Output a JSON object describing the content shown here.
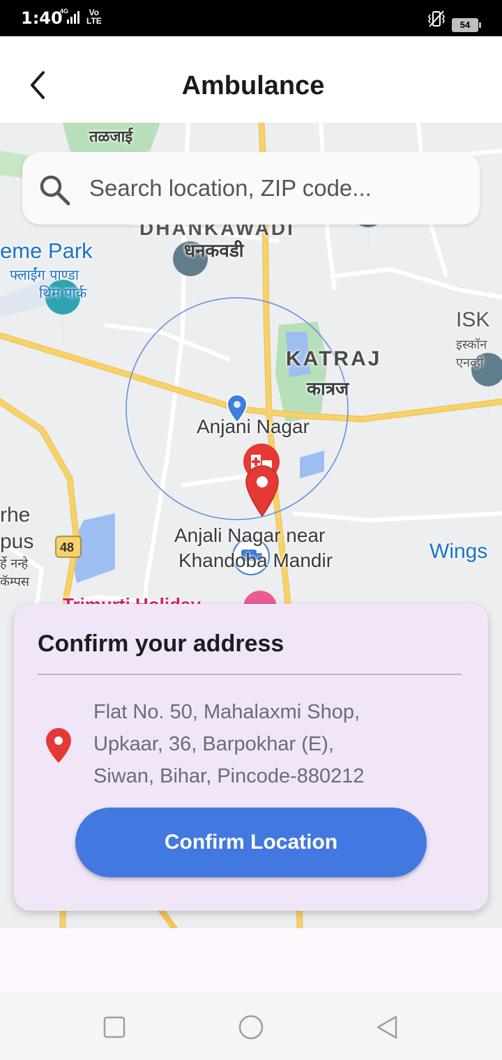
{
  "status_bar": {
    "time": "1:40",
    "network": "4G",
    "volte_top": "Vo",
    "volte_bottom": "LTE",
    "battery": "54"
  },
  "app_bar": {
    "title": "Ambulance",
    "back_icon": "back-arrow-icon"
  },
  "search": {
    "placeholder": "Search location, ZIP code...",
    "value": "",
    "icon": "search-icon"
  },
  "map": {
    "labels": {
      "talajai": "तळजाई",
      "dhankawadi": "DHANKAWADI",
      "dhankawadi_hi": "धनकवडी",
      "theme_park": "eme Park",
      "theme_park_hi1": "फ्लाईंग पाण्डा",
      "theme_park_hi2": "थिम पार्क",
      "katraj": "KATRAJ",
      "katraj_hi": "कात्रज",
      "isk": "ISK",
      "isk_hi1": "इस्कॉन",
      "isk_hi2": "एनव्ही",
      "anjani_nagar": "Anjani Nagar",
      "anjali_nagar1": "Anjali Nagar near",
      "anjali_nagar2": "Khandoba Mandir",
      "wings": "Wings",
      "highway": "48",
      "rhe": "rhe",
      "pus": "pus",
      "rhe_hi1": "र्हे नन्हे",
      "rhe_hi2": "कॅम्पस",
      "trimurti": "Trimurti Holiday"
    },
    "colors": {
      "road_major": "#f7d26b",
      "road_minor": "#ffffff",
      "park": "#b7dfb9",
      "water": "#9dbef0",
      "radius_circle": "#5b8ee0",
      "user_pin": "#3d7ddd",
      "selected_pin": "#e53935"
    }
  },
  "address_card": {
    "title": "Confirm your address",
    "address_line1": "Flat No. 50, Mahalaxmi Shop,",
    "address_line2": "Upkaar, 36, Barpokhar (E),",
    "address_line3": "Siwan, Bihar, Pincode-880212",
    "pin_icon": "location-pin-icon",
    "confirm_label": "Confirm Location",
    "accent": "#4278e0",
    "background": "#f0e6f7"
  },
  "nav_bar": {
    "recent": "square-icon",
    "home": "circle-icon",
    "back": "triangle-back-icon"
  }
}
